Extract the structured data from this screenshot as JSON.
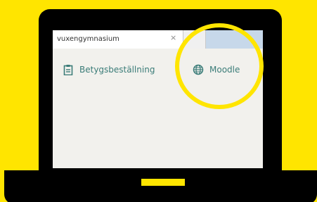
{
  "browser": {
    "tabs": [
      {
        "title": "vuxengymnasium",
        "close_label": "×"
      }
    ]
  },
  "bookmarks": [
    {
      "label": "Betygsbeställning",
      "icon": "clipboard-icon"
    },
    {
      "label": "Moodle",
      "icon": "globe-icon"
    }
  ],
  "colors": {
    "background": "#ffe500",
    "laptop": "#000000",
    "highlight": "#ffe500",
    "bookmark_text": "#3b7c78"
  }
}
